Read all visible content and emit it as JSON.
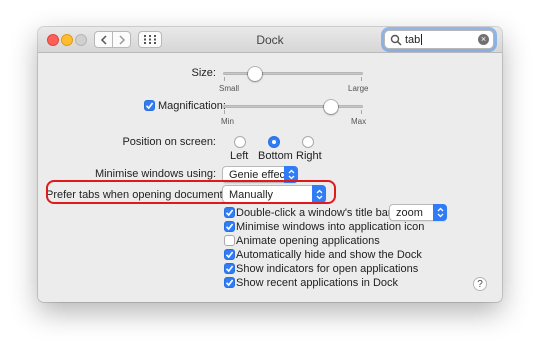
{
  "window": {
    "title": "Dock",
    "search": {
      "value": "tab",
      "clear_icon": "clear-icon"
    }
  },
  "size": {
    "label": "Size:",
    "min_label": "Small",
    "max_label": "Large",
    "value_fraction": 0.23
  },
  "magnification": {
    "label": "Magnification:",
    "checked": true,
    "min_label": "Min",
    "max_label": "Max",
    "value_fraction": 0.77
  },
  "position": {
    "label": "Position on screen:",
    "options": [
      "Left",
      "Bottom",
      "Right"
    ],
    "selected": "Bottom"
  },
  "minimise": {
    "label": "Minimise windows using:",
    "value": "Genie effect"
  },
  "prefer_tabs": {
    "label": "Prefer tabs when opening documents:",
    "value": "Manually"
  },
  "options": [
    {
      "label": "Double-click a window's title bar to",
      "checked": true
    },
    {
      "label": "Minimise windows into application icon",
      "checked": true
    },
    {
      "label": "Animate opening applications",
      "checked": false
    },
    {
      "label": "Automatically hide and show the Dock",
      "checked": true
    },
    {
      "label": "Show indicators for open applications",
      "checked": true
    },
    {
      "label": "Show recent applications in Dock",
      "checked": true
    }
  ],
  "double_click_action": {
    "value": "zoom"
  },
  "help": {
    "label": "?"
  },
  "colors": {
    "accent": "#2f7cf6",
    "highlight": "#e0191b"
  }
}
